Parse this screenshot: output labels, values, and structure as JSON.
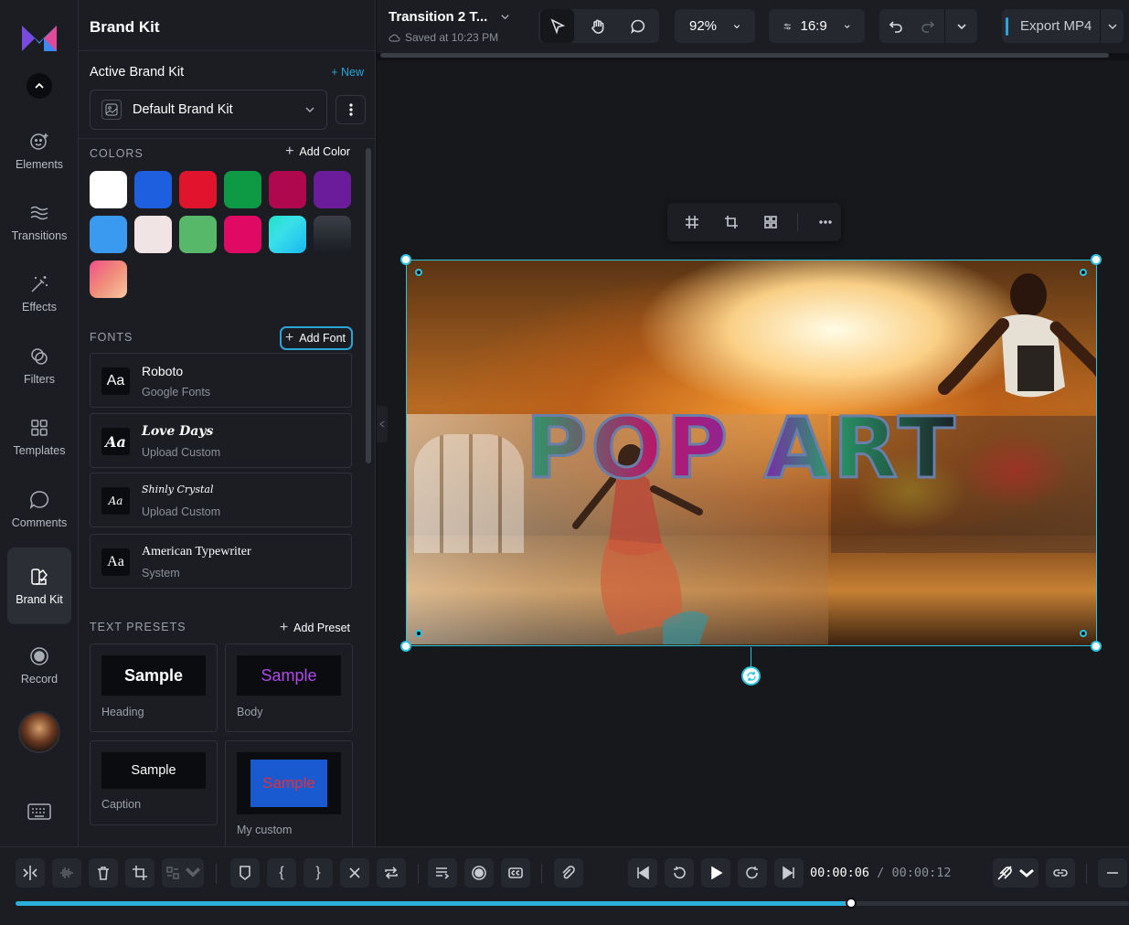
{
  "rail": {
    "items": [
      {
        "label": "Elements",
        "icon": "elements-icon"
      },
      {
        "label": "Transitions",
        "icon": "transitions-icon"
      },
      {
        "label": "Effects",
        "icon": "effects-icon"
      },
      {
        "label": "Filters",
        "icon": "filters-icon"
      },
      {
        "label": "Templates",
        "icon": "templates-icon"
      },
      {
        "label": "Comments",
        "icon": "comments-icon"
      },
      {
        "label": "Brand Kit",
        "icon": "brand-kit-icon",
        "active": true
      },
      {
        "label": "Record",
        "icon": "record-icon"
      }
    ]
  },
  "panel": {
    "title": "Brand Kit",
    "active_label": "Active Brand Kit",
    "new_label": "+ New",
    "kit_name": "Default Brand Kit",
    "colors_label": "COLORS",
    "add_color": "Add Color",
    "colors": [
      "#ffffff",
      "#1e5fe0",
      "#e0142d",
      "#0e9a44",
      "#b0084e",
      "#6a1c9a",
      "#3a9af0",
      "#f0e4e4",
      "#58b86a",
      "#e00a64",
      "linear-gradient(135deg,#22e0c8,#3ae0e8 40%,#18b8f0)",
      "linear-gradient(180deg,#3a3f48,#1a1d22)",
      "linear-gradient(135deg,#f0508a,#f08c7a 50%,#f8c8a0)"
    ],
    "fonts_label": "FONTS",
    "add_font": "Add Font",
    "fonts": [
      {
        "name": "Roboto",
        "source": "Google Fonts",
        "aa": "Aa"
      },
      {
        "name": "Love Days",
        "source": "Upload Custom",
        "aa": "Aa"
      },
      {
        "name": "Shinly Crystal",
        "source": "Upload Custom",
        "aa": "Aa"
      },
      {
        "name": "American Typewriter",
        "source": "System",
        "aa": "Aa"
      }
    ],
    "presets_label": "TEXT PRESETS",
    "add_preset": "Add Preset",
    "presets": [
      {
        "sample": "Sample",
        "label": "Heading"
      },
      {
        "sample": "Sample",
        "label": "Body"
      },
      {
        "sample": "Sample",
        "label": "Caption"
      },
      {
        "sample": "Sample",
        "label": "My custom"
      }
    ]
  },
  "topbar": {
    "doc_title": "Transition 2 T...",
    "saved": "Saved at 10:23 PM",
    "zoom": "92%",
    "aspect": "16:9",
    "export": "Export MP4"
  },
  "canvas": {
    "title_text": "POP ART"
  },
  "timeline": {
    "current": "00:00:06",
    "separator": "/",
    "total": "00:00:12",
    "progress": 0.5,
    "accent": "#2ab0d9"
  }
}
